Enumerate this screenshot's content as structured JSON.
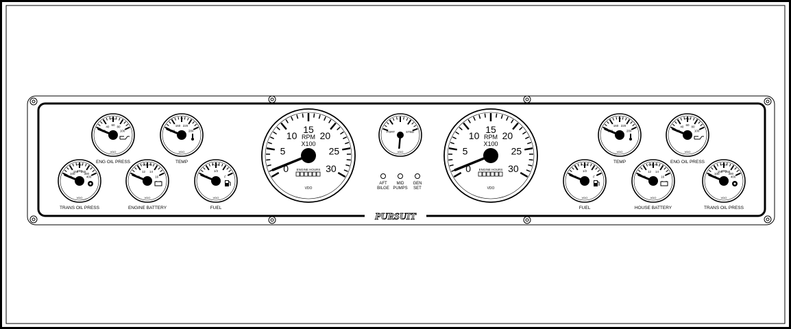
{
  "brand": "PURSUIT",
  "gauges": [
    {
      "id": "eng-oil-press-left",
      "label": "ENG OIL PRESS",
      "unit": "PSI",
      "maker": "VDO",
      "ticks": [
        "20",
        "40",
        "60",
        "80",
        "100"
      ],
      "icon": "oil-can-icon",
      "needle_fraction": 0.05
    },
    {
      "id": "temp-left",
      "label": "TEMP",
      "unit": "°F",
      "maker": "VDO",
      "ticks": [
        "100",
        "160",
        "220",
        "280"
      ],
      "icon": "thermometer-icon",
      "needle_fraction": 0.05
    },
    {
      "id": "trans-oil-press-left",
      "label": "TRANS OIL PRESS",
      "unit": "PSI",
      "maker": "VDO",
      "ticks": [
        "50",
        "100",
        "150",
        "200",
        "250",
        "300",
        "400"
      ],
      "icon": "gear-icon",
      "needle_fraction": 0.05
    },
    {
      "id": "engine-battery",
      "label": "ENGINE BATTERY",
      "unit": "VOLTS",
      "maker": "VDO",
      "ticks": [
        "10",
        "12",
        "14",
        "16"
      ],
      "icon": "battery-icon",
      "needle_fraction": 0.05
    },
    {
      "id": "fuel-left",
      "label": "FUEL",
      "unit": "FUEL",
      "maker": "VDO",
      "ticks": [
        "E",
        "1/2",
        "F"
      ],
      "icon": "fuel-pump-icon",
      "needle_fraction": 0.05
    },
    {
      "id": "rudder",
      "label": "",
      "unit": "",
      "maker": "VDO",
      "ticks": [
        "PORT",
        "STBD"
      ],
      "icon": "",
      "needle_fraction": 0.5
    },
    {
      "id": "fuel-right",
      "label": "FUEL",
      "unit": "FUEL",
      "maker": "VDO",
      "ticks": [
        "E",
        "1/2",
        "F"
      ],
      "icon": "fuel-pump-icon",
      "needle_fraction": 0.05
    },
    {
      "id": "house-battery",
      "label": "HOUSE BATTERY",
      "unit": "VOLTS",
      "maker": "VDO",
      "ticks": [
        "10",
        "12",
        "14",
        "16"
      ],
      "icon": "battery-icon",
      "needle_fraction": 0.05
    },
    {
      "id": "temp-right",
      "label": "TEMP",
      "unit": "°F",
      "maker": "VDO",
      "ticks": [
        "100",
        "160",
        "220",
        "280"
      ],
      "icon": "thermometer-icon",
      "needle_fraction": 0.05
    },
    {
      "id": "eng-oil-press-right",
      "label": "ENG OIL PRESS",
      "unit": "PSI",
      "maker": "VDO",
      "ticks": [
        "20",
        "40",
        "60",
        "80",
        "100"
      ],
      "icon": "oil-can-icon",
      "needle_fraction": 0.05
    },
    {
      "id": "trans-oil-press-right",
      "label": "TRANS OIL PRESS",
      "unit": "PSI",
      "maker": "VDO",
      "ticks": [
        "50",
        "100",
        "150",
        "200",
        "250",
        "300",
        "400"
      ],
      "icon": "gear-icon",
      "needle_fraction": 0.05
    }
  ],
  "tachometers": [
    {
      "id": "tach-left",
      "title": "RPM",
      "subtitle": "X100",
      "hours": "ENGINE HOURS",
      "maker": "VDO",
      "scale": [
        "0",
        "5",
        "10",
        "15",
        "20",
        "25",
        "30"
      ],
      "needle_value": 0
    },
    {
      "id": "tach-right",
      "title": "RPM",
      "subtitle": "X100",
      "hours": "ENGINE HOURS",
      "maker": "VDO",
      "scale": [
        "0",
        "5",
        "10",
        "15",
        "20",
        "25",
        "30"
      ],
      "needle_value": 0
    }
  ],
  "switches": [
    {
      "id": "aft-bilge",
      "line1": "AFT",
      "line2": "BILGE"
    },
    {
      "id": "mid-pumps",
      "line1": "MID",
      "line2": "PUMPS"
    },
    {
      "id": "gen-set",
      "line1": "GEN",
      "line2": "SET"
    }
  ]
}
